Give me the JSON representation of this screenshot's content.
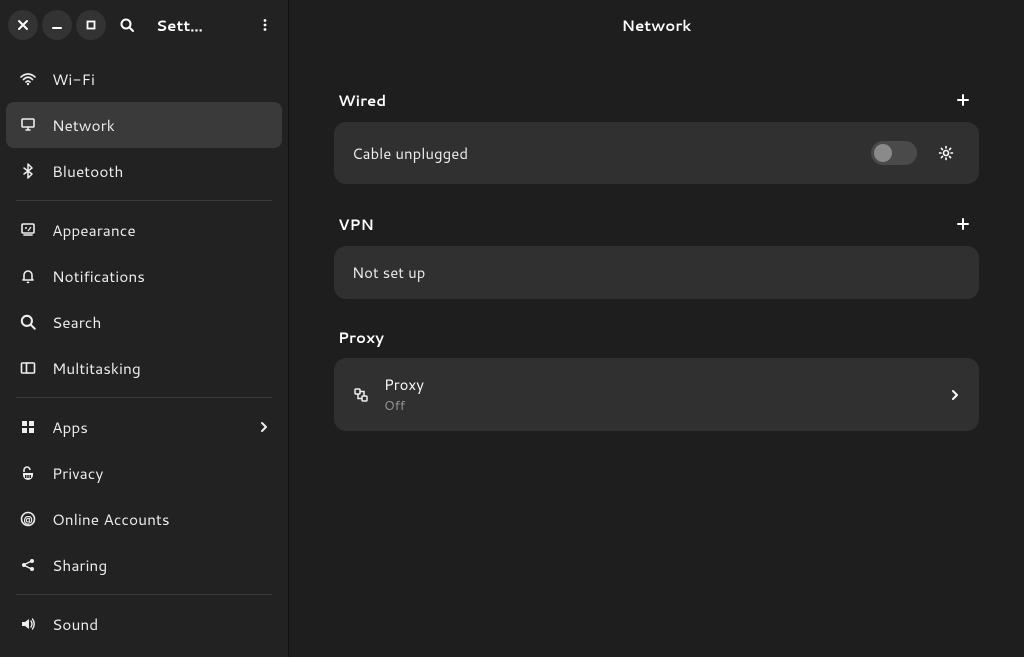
{
  "titlebar": {
    "app_title": "Sett…"
  },
  "sidebar": {
    "items": [
      {
        "label": "Wi-Fi"
      },
      {
        "label": "Network"
      },
      {
        "label": "Bluetooth"
      },
      {
        "label": "Appearance"
      },
      {
        "label": "Notifications"
      },
      {
        "label": "Search"
      },
      {
        "label": "Multitasking"
      },
      {
        "label": "Apps"
      },
      {
        "label": "Privacy"
      },
      {
        "label": "Online Accounts"
      },
      {
        "label": "Sharing"
      },
      {
        "label": "Sound"
      }
    ]
  },
  "main": {
    "title": "Network",
    "wired": {
      "heading": "Wired",
      "status": "Cable unplugged"
    },
    "vpn": {
      "heading": "VPN",
      "status": "Not set up"
    },
    "proxy": {
      "heading": "Proxy",
      "label": "Proxy",
      "status": "Off"
    }
  }
}
